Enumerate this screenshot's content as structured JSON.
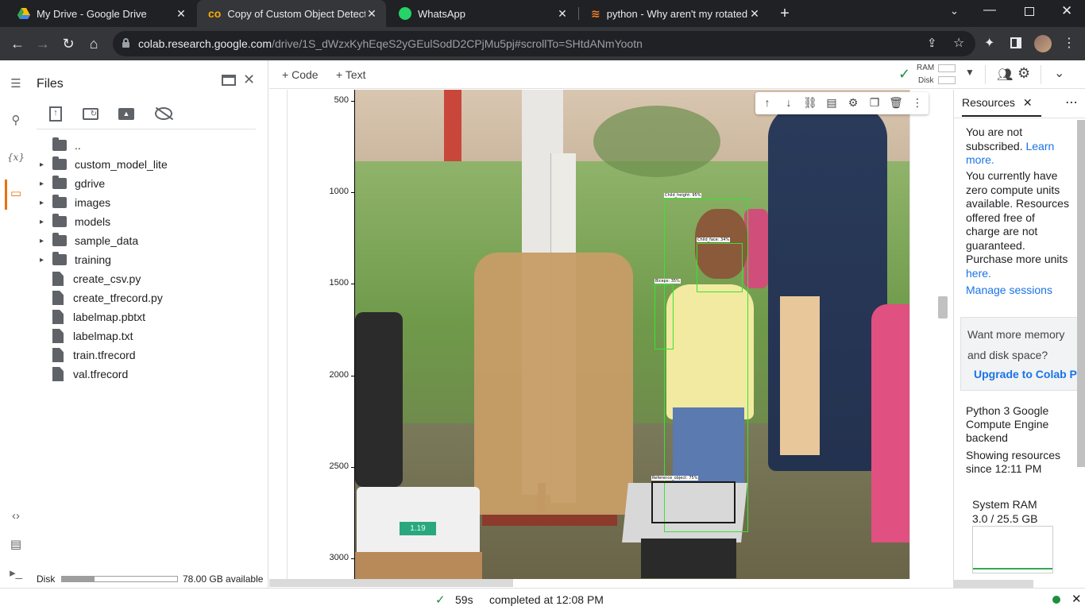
{
  "browser": {
    "tabs": [
      {
        "title": "My Drive - Google Drive",
        "icon": "google-drive-icon"
      },
      {
        "title": "Copy of Custom Object Detection",
        "icon": "colab-icon"
      },
      {
        "title": "WhatsApp",
        "icon": "whatsapp-icon"
      },
      {
        "title": "python - Why aren't my rotated i",
        "icon": "stackoverflow-icon"
      }
    ],
    "active_tab": 1,
    "url_host": "colab.research.google.com",
    "url_path": "/drive/1S_dWzxKyhEqeS2yGEulSodD2CPjMu5pj#scrollTo=SHtdANmYootn",
    "new_tab": "+"
  },
  "colab": {
    "toolbar": {
      "add_code": "Code",
      "add_text": "Text",
      "ram_label": "RAM",
      "disk_label": "Disk"
    },
    "files": {
      "title": "Files",
      "items": [
        {
          "name": "..",
          "type": "parent"
        },
        {
          "name": "custom_model_lite",
          "type": "folder"
        },
        {
          "name": "gdrive",
          "type": "folder"
        },
        {
          "name": "images",
          "type": "folder"
        },
        {
          "name": "models",
          "type": "folder"
        },
        {
          "name": "sample_data",
          "type": "folder"
        },
        {
          "name": "training",
          "type": "folder"
        },
        {
          "name": "create_csv.py",
          "type": "file"
        },
        {
          "name": "create_tfrecord.py",
          "type": "file"
        },
        {
          "name": "labelmap.pbtxt",
          "type": "file"
        },
        {
          "name": "labelmap.txt",
          "type": "file"
        },
        {
          "name": "train.tfrecord",
          "type": "file"
        },
        {
          "name": "val.tfrecord",
          "type": "file"
        }
      ],
      "disk_label": "Disk",
      "disk_available": "78.00 GB available",
      "disk_used_fraction": 0.28
    },
    "plot": {
      "y_ticks": [
        "500",
        "1000",
        "1500",
        "2000",
        "2500",
        "3000"
      ],
      "detections": [
        {
          "label": "Child_height: 95%"
        },
        {
          "label": "Child_face: 34%"
        },
        {
          "label": "Biceps: 35%"
        },
        {
          "label": "Reference_object: 75%"
        }
      ],
      "scale_display": "1.19"
    },
    "resources": {
      "title": "Resources",
      "not_subscribed": "You are not subscribed.",
      "learn_more": "Learn more.",
      "compute_units": "You currently have zero compute units available. Resources offered free of charge are not guaranteed. Purchase more units",
      "here": "here.",
      "manage_sessions": "Manage sessions",
      "promo_text": "Want more memory and disk space?",
      "upgrade": "Upgrade to Colab Pro",
      "backend": "Python 3 Google Compute Engine backend",
      "showing": "Showing resources since 12:11 PM",
      "system_ram_label": "System RAM",
      "system_ram_value": "3.0 / 25.5 GB"
    },
    "status": {
      "duration": "59s",
      "completed": "completed at 12:08 PM"
    }
  },
  "colors": {
    "accent": "#1a73e8",
    "ok_green": "#1e8e3e",
    "folder_orange": "#e8710a",
    "bbox_green": "#33e633"
  }
}
